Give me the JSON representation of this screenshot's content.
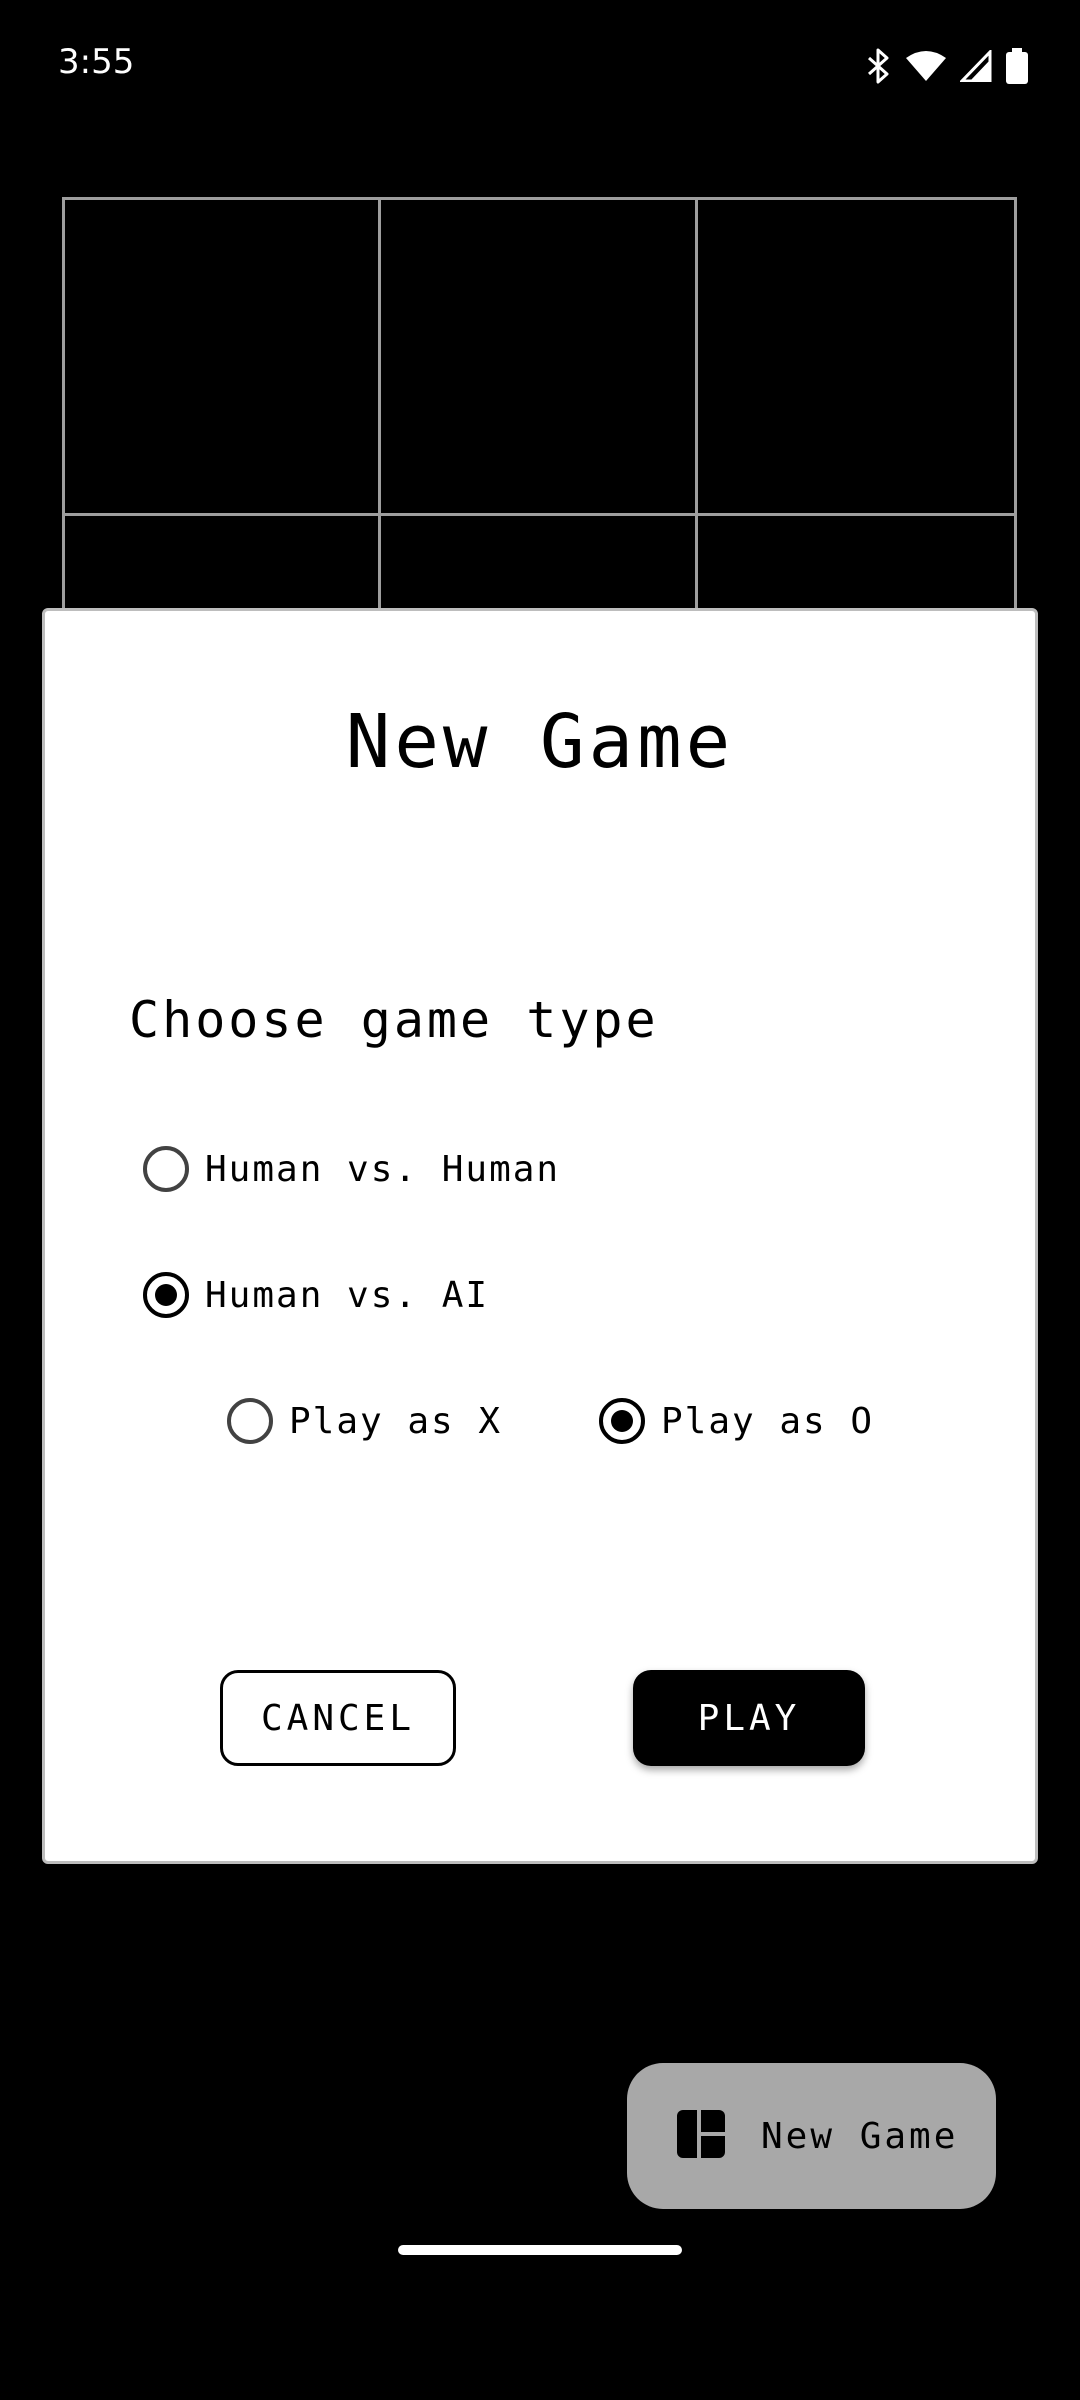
{
  "status_bar": {
    "time": "3:55",
    "icons": [
      "bluetooth-icon",
      "wifi-icon",
      "signal-icon",
      "battery-icon"
    ]
  },
  "board": {
    "cells": [
      "",
      "",
      "",
      "",
      "",
      "",
      "",
      "",
      ""
    ]
  },
  "dialog": {
    "title": "New Game",
    "section_label": "Choose game type",
    "game_types": [
      {
        "label": "Human vs. Human",
        "selected": false
      },
      {
        "label": "Human vs. AI",
        "selected": true
      }
    ],
    "play_as": [
      {
        "label": "Play as X",
        "selected": false
      },
      {
        "label": "Play as O",
        "selected": true
      }
    ],
    "cancel_label": "CANCEL",
    "play_label": "PLAY"
  },
  "fab": {
    "label": "New Game",
    "icon": "board-layout-icon"
  },
  "colors": {
    "background": "#000000",
    "dialog": "#ffffff",
    "grid_line": "#9e9e9e",
    "fab": "#a8a8a8"
  }
}
